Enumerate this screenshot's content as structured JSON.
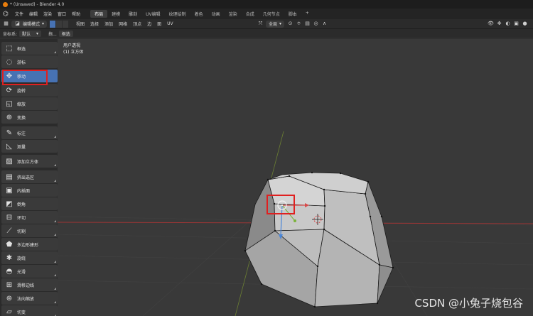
{
  "window": {
    "title": "* (Unsaved) - Blender 4.0"
  },
  "menubar": {
    "items": [
      "文件",
      "编辑",
      "渲染",
      "窗口",
      "帮助"
    ],
    "workspaces": [
      "布局",
      "建模",
      "雕刻",
      "UV编辑",
      "纹理绘制",
      "着色",
      "动画",
      "渲染",
      "合成",
      "几何节点",
      "脚本",
      "+"
    ],
    "active_workspace": "布局"
  },
  "header": {
    "mode": "编辑模式",
    "menus": [
      "视图",
      "选择",
      "添加",
      "网格",
      "顶点",
      "边",
      "面",
      "UV"
    ],
    "transform_orientation": "全局"
  },
  "options_bar": {
    "orientation_label": "坐标系:",
    "orientation_value": "默认",
    "drag_label": "拖...",
    "drag_value": "框选"
  },
  "toolbar": {
    "tools": [
      {
        "label": "框选",
        "icon": "box-select-icon",
        "active": false
      },
      {
        "label": "游标",
        "icon": "cursor-icon",
        "active": false
      },
      {
        "label": "移动",
        "icon": "move-icon",
        "active": true
      },
      {
        "label": "旋转",
        "icon": "rotate-icon",
        "active": false
      },
      {
        "label": "缩放",
        "icon": "scale-icon",
        "active": false
      },
      {
        "label": "变换",
        "icon": "transform-icon",
        "active": false
      },
      {
        "label": "标注",
        "icon": "annotate-icon",
        "active": false
      },
      {
        "label": "测量",
        "icon": "measure-icon",
        "active": false
      },
      {
        "label": "添加立方体",
        "icon": "add-cube-icon",
        "active": false
      },
      {
        "label": "挤出选区",
        "icon": "extrude-icon",
        "active": false
      },
      {
        "label": "内插面",
        "icon": "inset-icon",
        "active": false
      },
      {
        "label": "倒角",
        "icon": "bevel-icon",
        "active": false
      },
      {
        "label": "环切",
        "icon": "loop-cut-icon",
        "active": false
      },
      {
        "label": "切割",
        "icon": "knife-icon",
        "active": false
      },
      {
        "label": "多边形建形",
        "icon": "poly-build-icon",
        "active": false
      },
      {
        "label": "旋绕",
        "icon": "spin-icon",
        "active": false
      },
      {
        "label": "光滑",
        "icon": "smooth-icon",
        "active": false
      },
      {
        "label": "滑移边线",
        "icon": "edge-slide-icon",
        "active": false
      },
      {
        "label": "法向缩放",
        "icon": "shrink-fatten-icon",
        "active": false
      },
      {
        "label": "切变",
        "icon": "shear-icon",
        "active": false
      }
    ]
  },
  "viewport": {
    "view_name": "用户透视",
    "object_name": "(1) 立方体"
  },
  "watermark": "CSDN @小兔子烧包谷",
  "colors": {
    "accent": "#4772b3",
    "highlight_box": "#e02020",
    "x_axis": "#b03a3a",
    "y_axis": "#7a9a3a",
    "mesh": "#bdbdbd",
    "blender_logo": "#e87d0d"
  }
}
